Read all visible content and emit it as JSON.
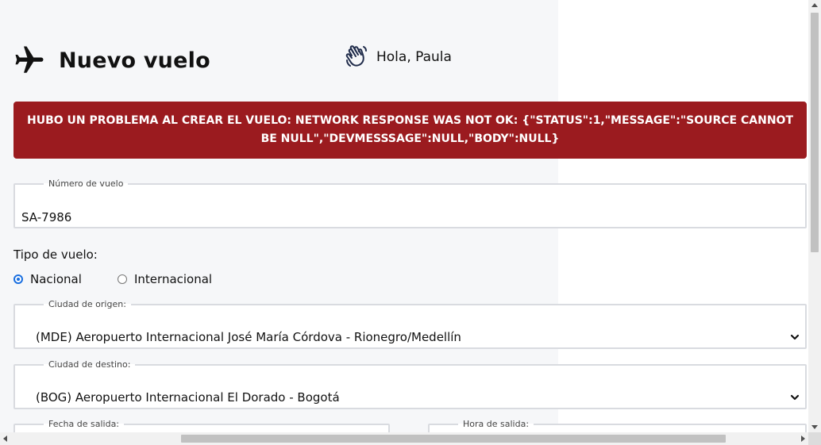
{
  "header": {
    "title": "Nuevo vuelo",
    "greeting": "Hola, Paula"
  },
  "error": {
    "message": "Hubo un problema al crear el vuelo: Network response was not ok: {\"status\":1,\"message\":\"Source cannot be null\",\"devMesssage\":null,\"body\":null}"
  },
  "form": {
    "flight_number": {
      "label": "Número de vuelo",
      "value": "SA-7986"
    },
    "flight_type": {
      "label": "Tipo de vuelo:",
      "options": [
        "Nacional",
        "Internacional"
      ],
      "selected": "Nacional"
    },
    "origin": {
      "label": "Ciudad de origen:",
      "value": "(MDE) Aeropuerto Internacional José María Córdova - Rionegro/Medellín"
    },
    "destination": {
      "label": "Ciudad de destino:",
      "value": "(BOG) Aeropuerto Internacional El Dorado - Bogotá"
    },
    "departure_date": {
      "label": "Fecha de salida:"
    },
    "departure_time": {
      "label": "Hora de salida:"
    }
  },
  "colors": {
    "error_bg": "#9b1b1f",
    "radio_accent": "#1a6fe0"
  },
  "icons": {
    "title": "airplane-icon",
    "greeting": "waving-hand-icon",
    "select": "chevron-down-icon"
  }
}
